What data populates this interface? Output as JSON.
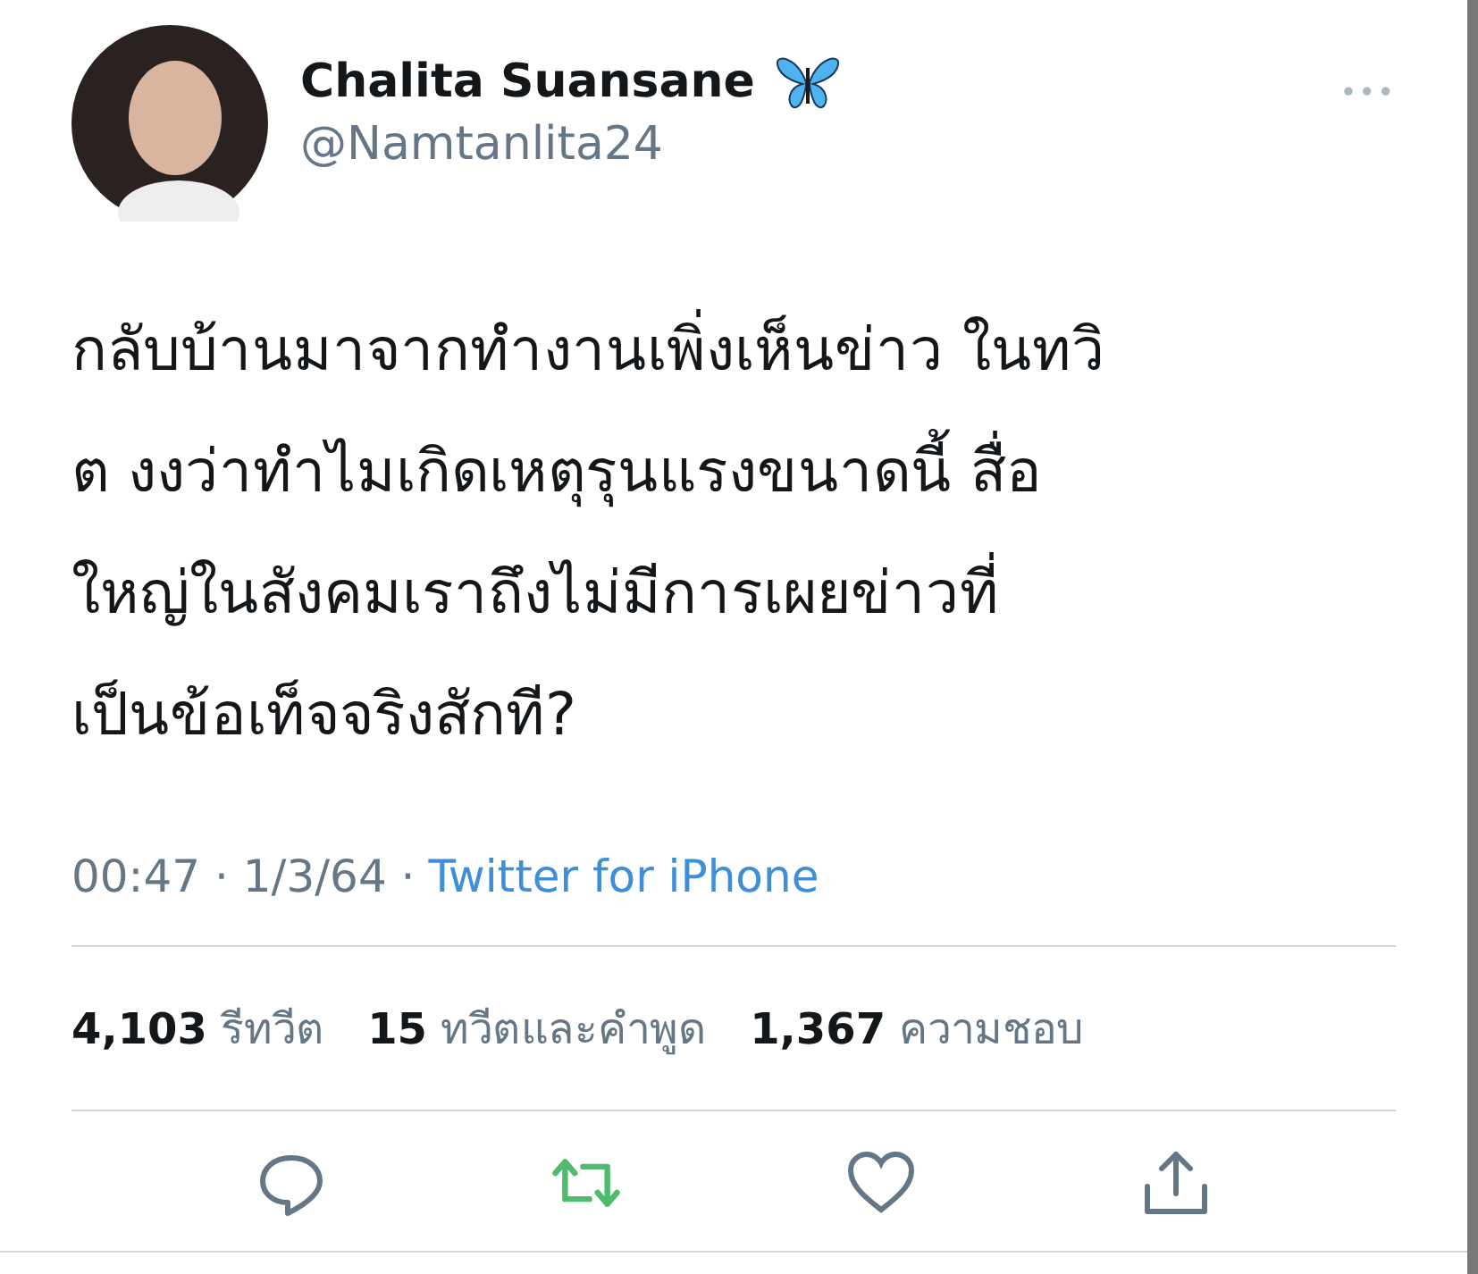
{
  "author": {
    "name": "Chalita Suansane",
    "handle": "@Namtanlita24",
    "more": "•••"
  },
  "tweet": {
    "text_lines": [
      "กลับบ้านมาจากทำงานเพิ่งเห็นข่าว ในทวิ",
      "ต งงว่าทำไมเกิดเหตุรุนแรงขนาดนี้ สื่อ",
      "ใหญ่ในสังคมเราถึงไม่มีการเผยข่าวที่",
      "เป็นข้อเท็จจริงสักที?"
    ],
    "timestamp": "00:47 · 1/3/64 ·",
    "source": "Twitter for iPhone"
  },
  "stats": [
    {
      "count": "4,103",
      "label": "รีทวีต"
    },
    {
      "count": "15",
      "label": "ทวีตและคำพูด"
    },
    {
      "count": "1,367",
      "label": "ความชอบ"
    }
  ],
  "actions": {
    "retweeted": true,
    "liked": false
  }
}
